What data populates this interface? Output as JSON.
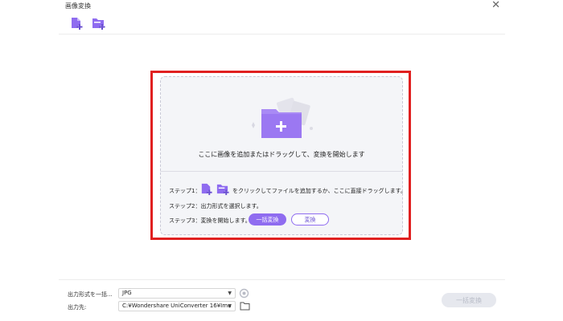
{
  "window": {
    "title": "画像変換",
    "close_label": "✕"
  },
  "toolbar": {
    "add_file_icon": "add-image-icon",
    "add_folder_icon": "add-folder-icon"
  },
  "dropzone": {
    "prompt": "ここに画像を追加またはドラッグして、変換を開始します",
    "step1_label": "ステップ1：",
    "step1_text": "をクリックしてファイルを追加するか、ここに直接ドラッグします。",
    "step2_text": "ステップ2：出力形式を選択します。",
    "step3_label": "ステップ3：変換を開始します。",
    "batch_convert_label": "一括変換",
    "convert_label": "変換"
  },
  "footer": {
    "format_label": "出力形式を一括...",
    "format_value": "JPG",
    "output_label": "出力先:",
    "output_value": "C:¥Wondershare UniConverter 16¥Imu",
    "batch_convert_label": "一括変換"
  },
  "colors": {
    "accent": "#8f6cf0",
    "highlight_border": "#e02020",
    "disabled_bg": "#e6e8ee"
  }
}
